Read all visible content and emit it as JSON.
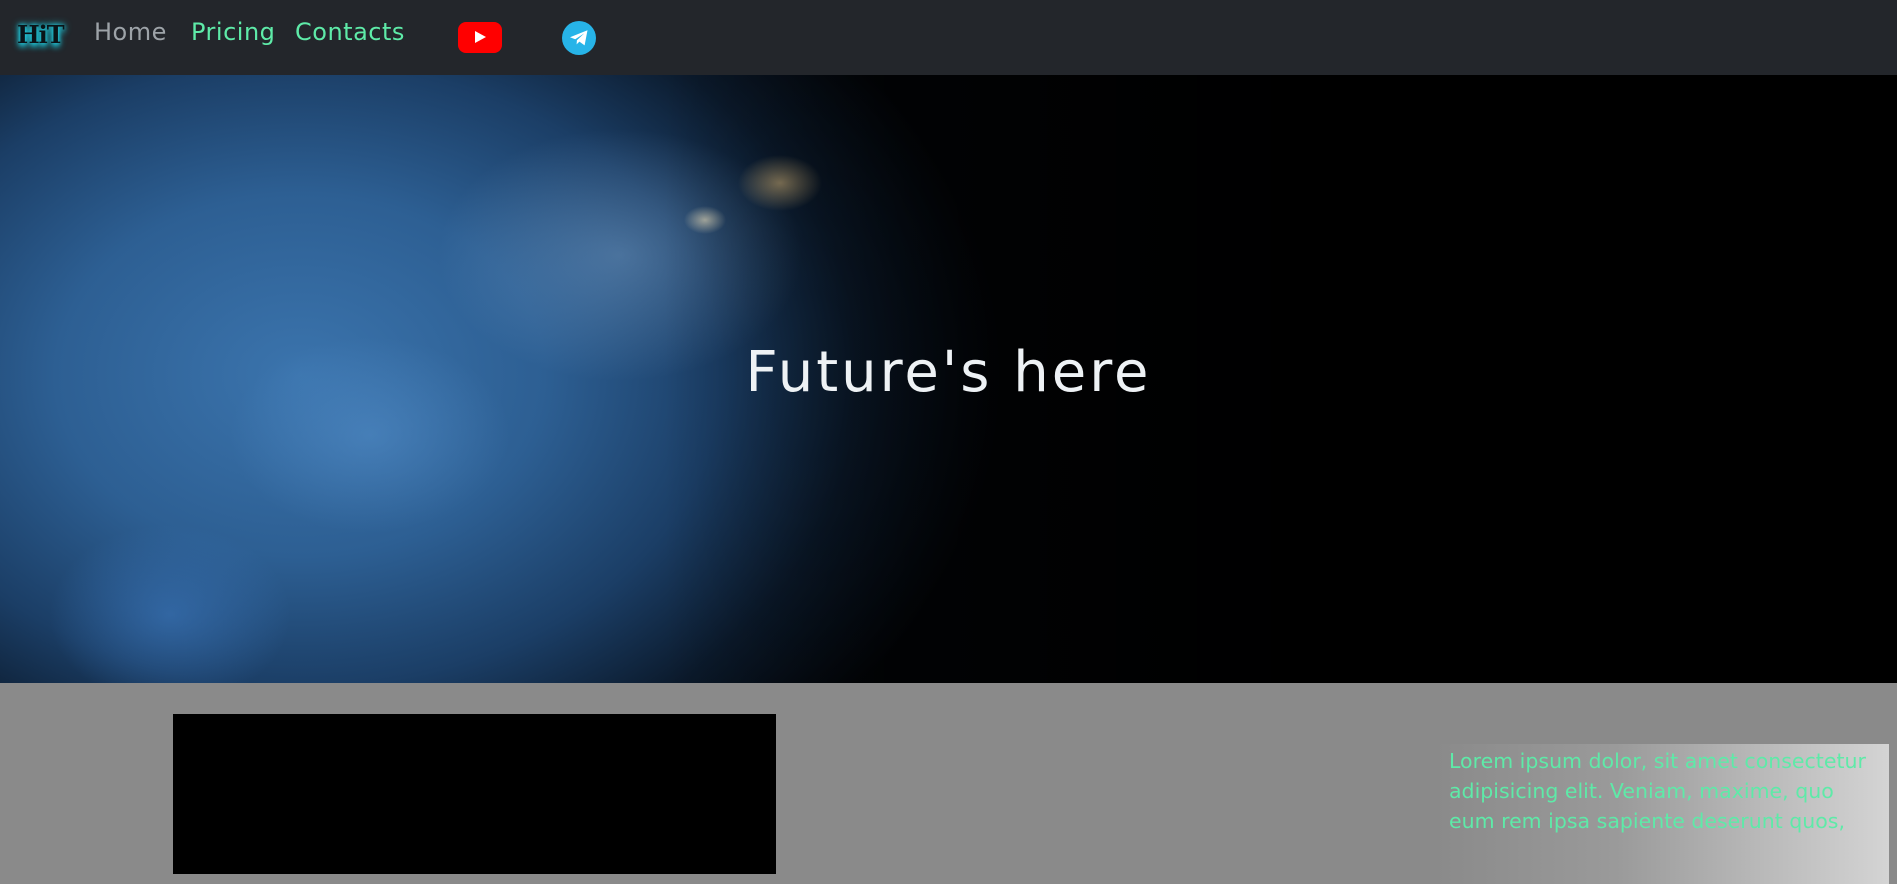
{
  "navbar": {
    "logo": "HiT",
    "links": [
      {
        "label": "Home"
      },
      {
        "label": "Pricing"
      },
      {
        "label": "Contacts"
      }
    ],
    "social": [
      {
        "icon": "youtube-icon",
        "color": "#ff0000"
      },
      {
        "icon": "telegram-icon",
        "color": "#27b4e8"
      }
    ],
    "colors": {
      "background": "#23262b",
      "link_accent": "#5eeaa8",
      "link_muted": "#9da3a8"
    }
  },
  "hero": {
    "title": "Future's here",
    "background": "earth-from-space-image"
  },
  "content": {
    "video_placeholder": "black-video-box",
    "card_text": "Lorem ipsum dolor, sit amet consectetur adipisicing elit. Veniam, maxime, quo eum rem ipsa sapiente deserunt quos,"
  }
}
